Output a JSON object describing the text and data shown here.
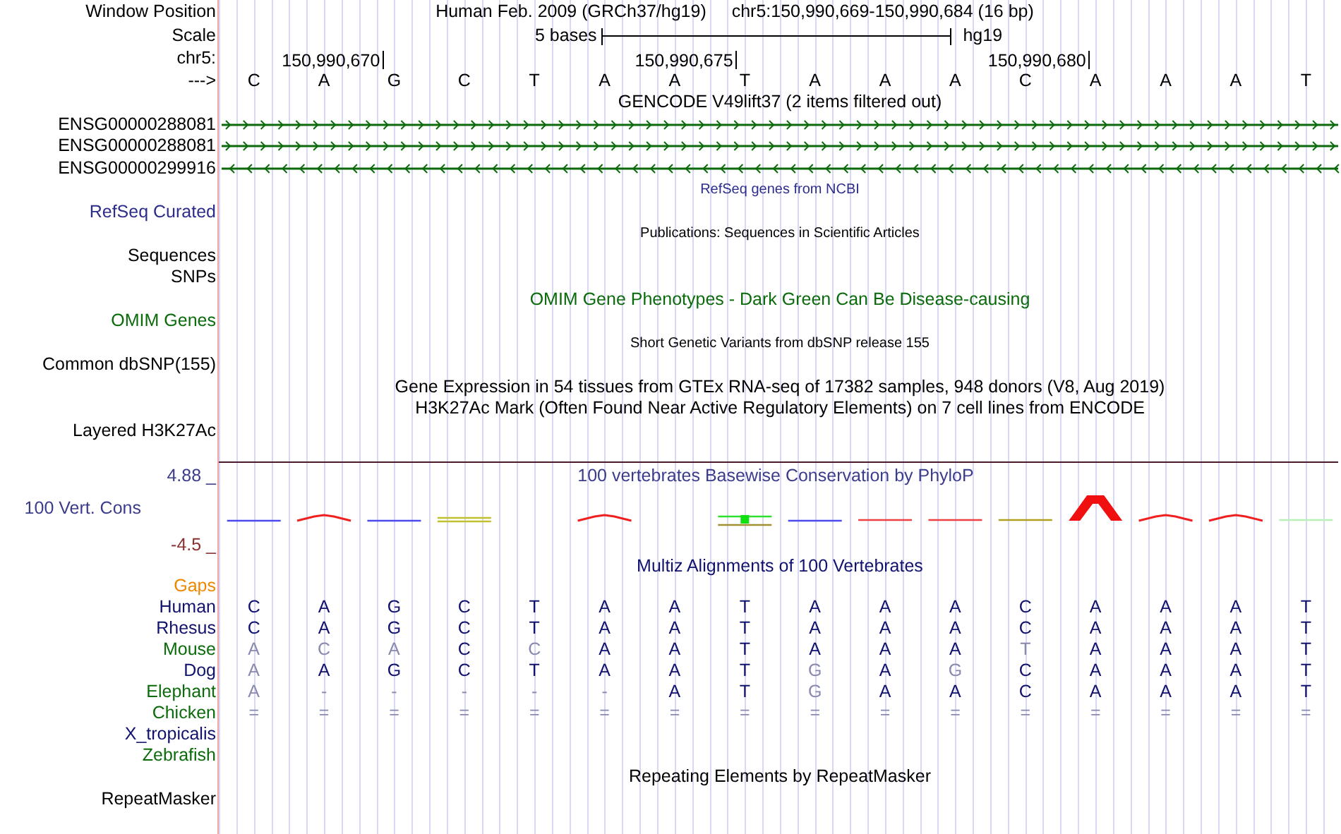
{
  "header": {
    "label": "Window Position",
    "assembly": "Human Feb. 2009 (GRCh37/hg19)",
    "position": "chr5:150,990,669-150,990,684 (16 bp)"
  },
  "scale": {
    "label": "Scale",
    "span": "5 bases",
    "assembly": "hg19"
  },
  "ruler": {
    "label": "chr5:"
  },
  "sequence": {
    "label": "--->",
    "bases": [
      {
        "letter": "C"
      },
      {
        "letter": "A",
        "tick": "150,990,670"
      },
      {
        "letter": "G"
      },
      {
        "letter": "C"
      },
      {
        "letter": "T"
      },
      {
        "letter": "A"
      },
      {
        "letter": "A",
        "tick": "150,990,675"
      },
      {
        "letter": "T"
      },
      {
        "letter": "A"
      },
      {
        "letter": "A"
      },
      {
        "letter": "A"
      },
      {
        "letter": "C",
        "tick": "150,990,680"
      },
      {
        "letter": "A"
      },
      {
        "letter": "A"
      },
      {
        "letter": "A"
      },
      {
        "letter": "T"
      }
    ]
  },
  "tracks": [
    {
      "kind": "genes",
      "title": "GENCODE V49lift37 (2 items filtered out)",
      "small_title": false,
      "color": "#000000",
      "genes": [
        {
          "name": "ENSG00000288081",
          "kind": "forward"
        },
        {
          "name": "ENSG00000288081",
          "kind": "forward"
        },
        {
          "name": "ENSG00000299916",
          "kind": "reverse"
        }
      ]
    },
    {
      "kind": "plain",
      "title": "RefSeq genes from NCBI",
      "small_title": true,
      "label": "RefSeq Curated",
      "color": "#2c2c8c"
    },
    {
      "kind": "plain",
      "title": "Publications: Sequences in Scientific Articles",
      "small_title": true,
      "label": "Sequences",
      "color": "#000000"
    },
    {
      "kind": "plain",
      "label": "SNPs",
      "color": "#000000"
    },
    {
      "kind": "plain",
      "title": "OMIM Gene Phenotypes - Dark Green Can Be Disease-causing",
      "small_title": false,
      "label": "OMIM Genes",
      "color": "#0b6b0b"
    },
    {
      "kind": "plain",
      "title": "Short Genetic Variants from dbSNP release 155",
      "small_title": true,
      "label": "Common dbSNP(155)",
      "color": "#000000"
    },
    {
      "kind": "plain",
      "title": "Gene Expression in 54 tissues from GTEx RNA-seq of 17382 samples, 948 donors (V8, Aug 2019)",
      "small_title": false,
      "color": "#000000"
    },
    {
      "kind": "plain",
      "title": "H3K27Ac Mark (Often Found Near Active Regulatory Elements) on 7 cell lines from ENCODE",
      "small_title": false,
      "label": "Layered H3K27Ac",
      "color": "#000000"
    },
    {
      "kind": "conservation",
      "title": "100 vertebrates Basewise Conservation by PhyloP",
      "label": "100 Vert. Cons",
      "max": "4.88 _",
      "min": "-4.5 _",
      "color": "#3c3c8c"
    },
    {
      "kind": "alignment",
      "title": "Multiz Alignments of 100 Vertebrates",
      "label": "Gaps",
      "color": "#11116e",
      "species": [
        {
          "name": "Human",
          "color": "#11116e",
          "bases": [
            {
              "letter": "C",
              "match": true
            },
            {
              "letter": "A",
              "match": true
            },
            {
              "letter": "G",
              "match": true
            },
            {
              "letter": "C",
              "match": true
            },
            {
              "letter": "T",
              "match": true
            },
            {
              "letter": "A",
              "match": true
            },
            {
              "letter": "A",
              "match": true
            },
            {
              "letter": "T",
              "match": true
            },
            {
              "letter": "A",
              "match": true
            },
            {
              "letter": "A",
              "match": true
            },
            {
              "letter": "A",
              "match": true
            },
            {
              "letter": "C",
              "match": true
            },
            {
              "letter": "A",
              "match": true
            },
            {
              "letter": "A",
              "match": true
            },
            {
              "letter": "A",
              "match": true
            },
            {
              "letter": "T",
              "match": true
            }
          ]
        },
        {
          "name": "Rhesus",
          "color": "#11116e",
          "bases": [
            {
              "letter": "C",
              "match": true
            },
            {
              "letter": "A",
              "match": true
            },
            {
              "letter": "G",
              "match": true
            },
            {
              "letter": "C",
              "match": true
            },
            {
              "letter": "T",
              "match": true
            },
            {
              "letter": "A",
              "match": true
            },
            {
              "letter": "A",
              "match": true
            },
            {
              "letter": "T",
              "match": true
            },
            {
              "letter": "A",
              "match": true
            },
            {
              "letter": "A",
              "match": true
            },
            {
              "letter": "A",
              "match": true
            },
            {
              "letter": "C",
              "match": true
            },
            {
              "letter": "A",
              "match": true
            },
            {
              "letter": "A",
              "match": true
            },
            {
              "letter": "A",
              "match": true
            },
            {
              "letter": "T",
              "match": true
            }
          ]
        },
        {
          "name": "Mouse",
          "color": "#0b6b0b",
          "bases": [
            {
              "letter": "A",
              "match": false
            },
            {
              "letter": "C",
              "match": false
            },
            {
              "letter": "A",
              "match": false
            },
            {
              "letter": "C",
              "match": true
            },
            {
              "letter": "C",
              "match": false
            },
            {
              "letter": "A",
              "match": true
            },
            {
              "letter": "A",
              "match": true
            },
            {
              "letter": "T",
              "match": true
            },
            {
              "letter": "A",
              "match": true
            },
            {
              "letter": "A",
              "match": true
            },
            {
              "letter": "A",
              "match": true
            },
            {
              "letter": "T",
              "match": false
            },
            {
              "letter": "A",
              "match": true
            },
            {
              "letter": "A",
              "match": true
            },
            {
              "letter": "A",
              "match": true
            },
            {
              "letter": "T",
              "match": true
            }
          ]
        },
        {
          "name": "Dog",
          "color": "#11116e",
          "bases": [
            {
              "letter": "A",
              "match": false
            },
            {
              "letter": "A",
              "match": true
            },
            {
              "letter": "G",
              "match": true
            },
            {
              "letter": "C",
              "match": true
            },
            {
              "letter": "T",
              "match": true
            },
            {
              "letter": "A",
              "match": true
            },
            {
              "letter": "A",
              "match": true
            },
            {
              "letter": "T",
              "match": true
            },
            {
              "letter": "G",
              "match": false
            },
            {
              "letter": "A",
              "match": true
            },
            {
              "letter": "G",
              "match": false
            },
            {
              "letter": "C",
              "match": true
            },
            {
              "letter": "A",
              "match": true
            },
            {
              "letter": "A",
              "match": true
            },
            {
              "letter": "A",
              "match": true
            },
            {
              "letter": "T",
              "match": true
            }
          ]
        },
        {
          "name": "Elephant",
          "color": "#0b6b0b",
          "bases": [
            {
              "letter": "A",
              "match": false
            },
            {
              "letter": "-",
              "match": false
            },
            {
              "letter": "-",
              "match": false
            },
            {
              "letter": "-",
              "match": false
            },
            {
              "letter": "-",
              "match": false
            },
            {
              "letter": "-",
              "match": false
            },
            {
              "letter": "A",
              "match": true
            },
            {
              "letter": "T",
              "match": true
            },
            {
              "letter": "G",
              "match": false
            },
            {
              "letter": "A",
              "match": true
            },
            {
              "letter": "A",
              "match": true
            },
            {
              "letter": "C",
              "match": true
            },
            {
              "letter": "A",
              "match": true
            },
            {
              "letter": "A",
              "match": true
            },
            {
              "letter": "A",
              "match": true
            },
            {
              "letter": "T",
              "match": true
            }
          ]
        },
        {
          "name": "Chicken",
          "color": "#0b6b0b",
          "bases": [
            {
              "letter": "=",
              "match": false
            },
            {
              "letter": "=",
              "match": false
            },
            {
              "letter": "=",
              "match": false
            },
            {
              "letter": "=",
              "match": false
            },
            {
              "letter": "=",
              "match": false
            },
            {
              "letter": "=",
              "match": false
            },
            {
              "letter": "=",
              "match": false
            },
            {
              "letter": "=",
              "match": false
            },
            {
              "letter": "=",
              "match": false
            },
            {
              "letter": "=",
              "match": false
            },
            {
              "letter": "=",
              "match": false
            },
            {
              "letter": "=",
              "match": false
            },
            {
              "letter": "=",
              "match": false
            },
            {
              "letter": "=",
              "match": false
            },
            {
              "letter": "=",
              "match": false
            },
            {
              "letter": "=",
              "match": false
            }
          ]
        },
        {
          "name": "X_tropicalis",
          "color": "#11116e"
        },
        {
          "name": "Zebrafish",
          "color": "#0b6b0b"
        }
      ]
    },
    {
      "kind": "plain",
      "title": "Repeating Elements by RepeatMasker",
      "small_title": false,
      "label": "RepeatMasker",
      "color": "#000000"
    }
  ]
}
